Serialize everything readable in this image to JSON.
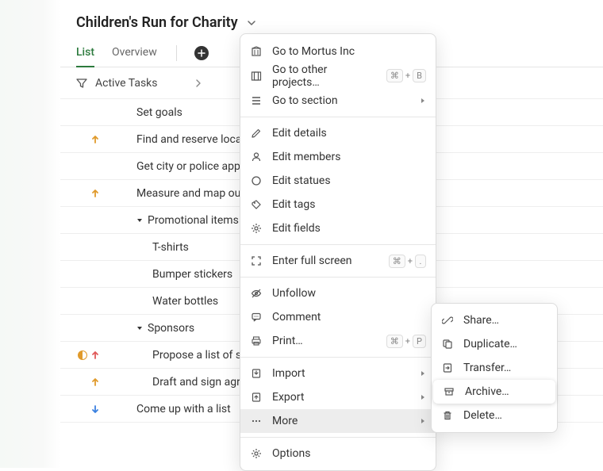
{
  "title": "Children's Run for Charity",
  "tabs": {
    "list": "List",
    "overview": "Overview"
  },
  "filter": "Active Tasks",
  "tasks": [
    {
      "title": "Set goals",
      "indent": 0
    },
    {
      "title": "Find and reserve location",
      "indent": 0,
      "priority": "up"
    },
    {
      "title": "Get city or police approval",
      "indent": 0
    },
    {
      "title": "Measure and map out course",
      "indent": 0,
      "priority": "up"
    },
    {
      "title": "Promotional items",
      "indent": 1,
      "collapsed": false
    },
    {
      "title": "T-shirts",
      "indent": 2
    },
    {
      "title": "Bumper stickers",
      "indent": 2
    },
    {
      "title": "Water bottles",
      "indent": 2
    },
    {
      "title": "Sponsors",
      "indent": 1,
      "collapsed": false
    },
    {
      "title": "Propose a list of sponsors",
      "indent": 2,
      "priority": "up-red",
      "half": true
    },
    {
      "title": "Draft and sign agreements",
      "indent": 2,
      "priority": "up"
    },
    {
      "title": "Come up with a list",
      "indent": 0,
      "priority": "down"
    }
  ],
  "menu": {
    "go_mortus": "Go to Mortus Inc",
    "go_other": "Go to other projects…",
    "go_section": "Go to section",
    "edit_details": "Edit details",
    "edit_members": "Edit members",
    "edit_statuses": "Edit statues",
    "edit_tags": "Edit tags",
    "edit_fields": "Edit fields",
    "full_screen": "Enter full screen",
    "unfollow": "Unfollow",
    "comment": "Comment",
    "print": "Print…",
    "import": "Import",
    "export": "Export",
    "more": "More",
    "options": "Options",
    "shortcut_cmd": "⌘",
    "shortcut_plus": "+",
    "shortcut_b": "B",
    "shortcut_dot": ".",
    "shortcut_p": "P"
  },
  "submenu": {
    "share": "Share…",
    "duplicate": "Duplicate…",
    "transfer": "Transfer…",
    "archive": "Archive…",
    "delete": "Delete…"
  }
}
